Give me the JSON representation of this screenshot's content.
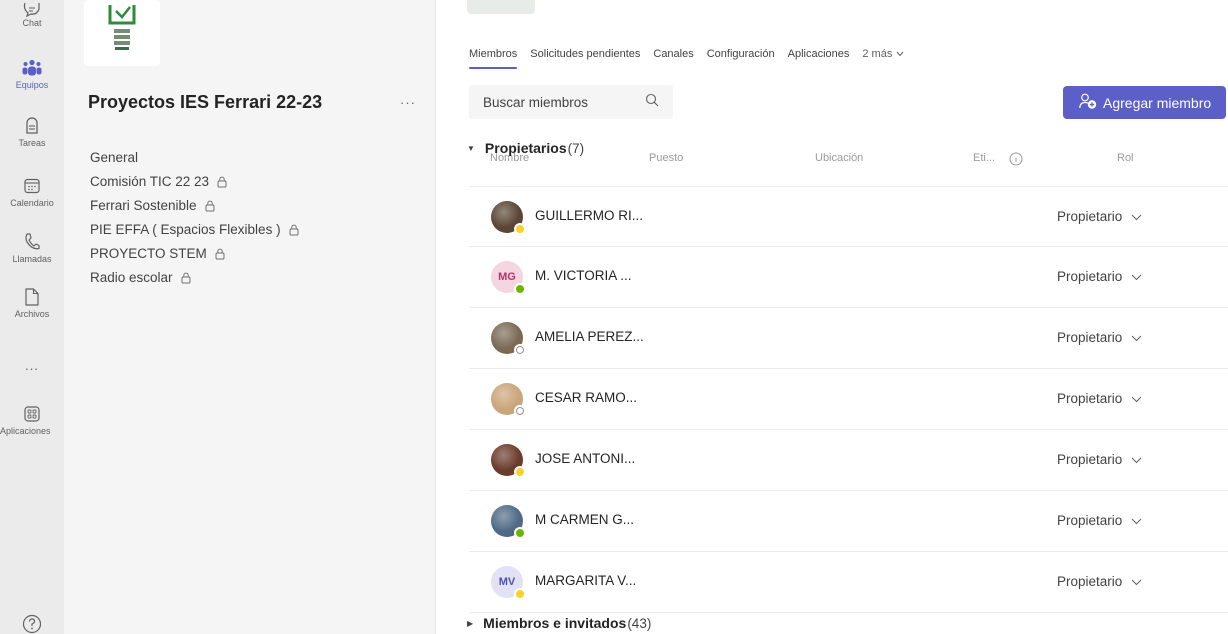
{
  "rail": {
    "items": [
      {
        "label": "Chat",
        "icon": "chat-icon"
      },
      {
        "label": "Equipos",
        "icon": "teams-icon",
        "active": true
      },
      {
        "label": "Tareas",
        "icon": "assignments-icon"
      },
      {
        "label": "Calendario",
        "icon": "calendar-icon"
      },
      {
        "label": "Llamadas",
        "icon": "calls-icon"
      },
      {
        "label": "Archivos",
        "icon": "files-icon"
      },
      {
        "label": "...",
        "icon": "more-icon"
      },
      {
        "label": "Aplicaciones",
        "icon": "apps-icon"
      }
    ]
  },
  "team": {
    "name": "Proyectos IES Ferrari 22-23",
    "more": "···",
    "channels": [
      {
        "name": "General",
        "private": false
      },
      {
        "name": "Comisión TIC 22 23",
        "private": true
      },
      {
        "name": "Ferrari Sostenible",
        "private": true
      },
      {
        "name": "PIE EFFA ( Espacios Flexibles )",
        "private": true
      },
      {
        "name": "PROYECTO STEM",
        "private": true
      },
      {
        "name": "Radio escolar",
        "private": true
      }
    ]
  },
  "tabs": [
    {
      "label": "Miembros",
      "active": true
    },
    {
      "label": "Solicitudes pendientes"
    },
    {
      "label": "Canales"
    },
    {
      "label": "Configuración"
    },
    {
      "label": "Aplicaciones"
    },
    {
      "label": "2 más"
    }
  ],
  "search": {
    "placeholder": "Buscar miembros"
  },
  "add_member_label": "Agregar miembro",
  "owners": {
    "title": "Propietarios",
    "count": "(7)"
  },
  "ghost_headers": [
    "Nombre",
    "Puesto",
    "Ubicación",
    "Eti...",
    "Rol"
  ],
  "owners_list": [
    {
      "name": "GUILLERMO RI...",
      "role": "Propietario",
      "initials": "",
      "presence": "away",
      "avatar_color": "#5a4636"
    },
    {
      "name": "M. VICTORIA ...",
      "role": "Propietario",
      "initials": "MG",
      "presence": "available",
      "avatar_color": "#f3d6e0",
      "initials_color": "#b4356a"
    },
    {
      "name": "AMELIA PEREZ...",
      "role": "Propietario",
      "initials": "",
      "presence": "offline",
      "avatar_color": "#7a6a54"
    },
    {
      "name": "CESAR RAMO...",
      "role": "Propietario",
      "initials": "",
      "presence": "offline",
      "avatar_color": "#c9a57a"
    },
    {
      "name": "JOSE ANTONI...",
      "role": "Propietario",
      "initials": "",
      "presence": "away",
      "avatar_color": "#6b3b2c"
    },
    {
      "name": "M CARMEN G...",
      "role": "Propietario",
      "initials": "",
      "presence": "available",
      "avatar_color": "#4e6a86"
    },
    {
      "name": "MARGARITA V...",
      "role": "Propietario",
      "initials": "MV",
      "presence": "away",
      "avatar_color": "#e2e1f5",
      "initials_color": "#4f52b2"
    }
  ],
  "members": {
    "title": "Miembros e invitados",
    "count": "(43)"
  },
  "colors": {
    "accent": "#5b5fc7",
    "available": "#6bb700",
    "away": "#f8d22a",
    "offline": "#ffffff"
  }
}
